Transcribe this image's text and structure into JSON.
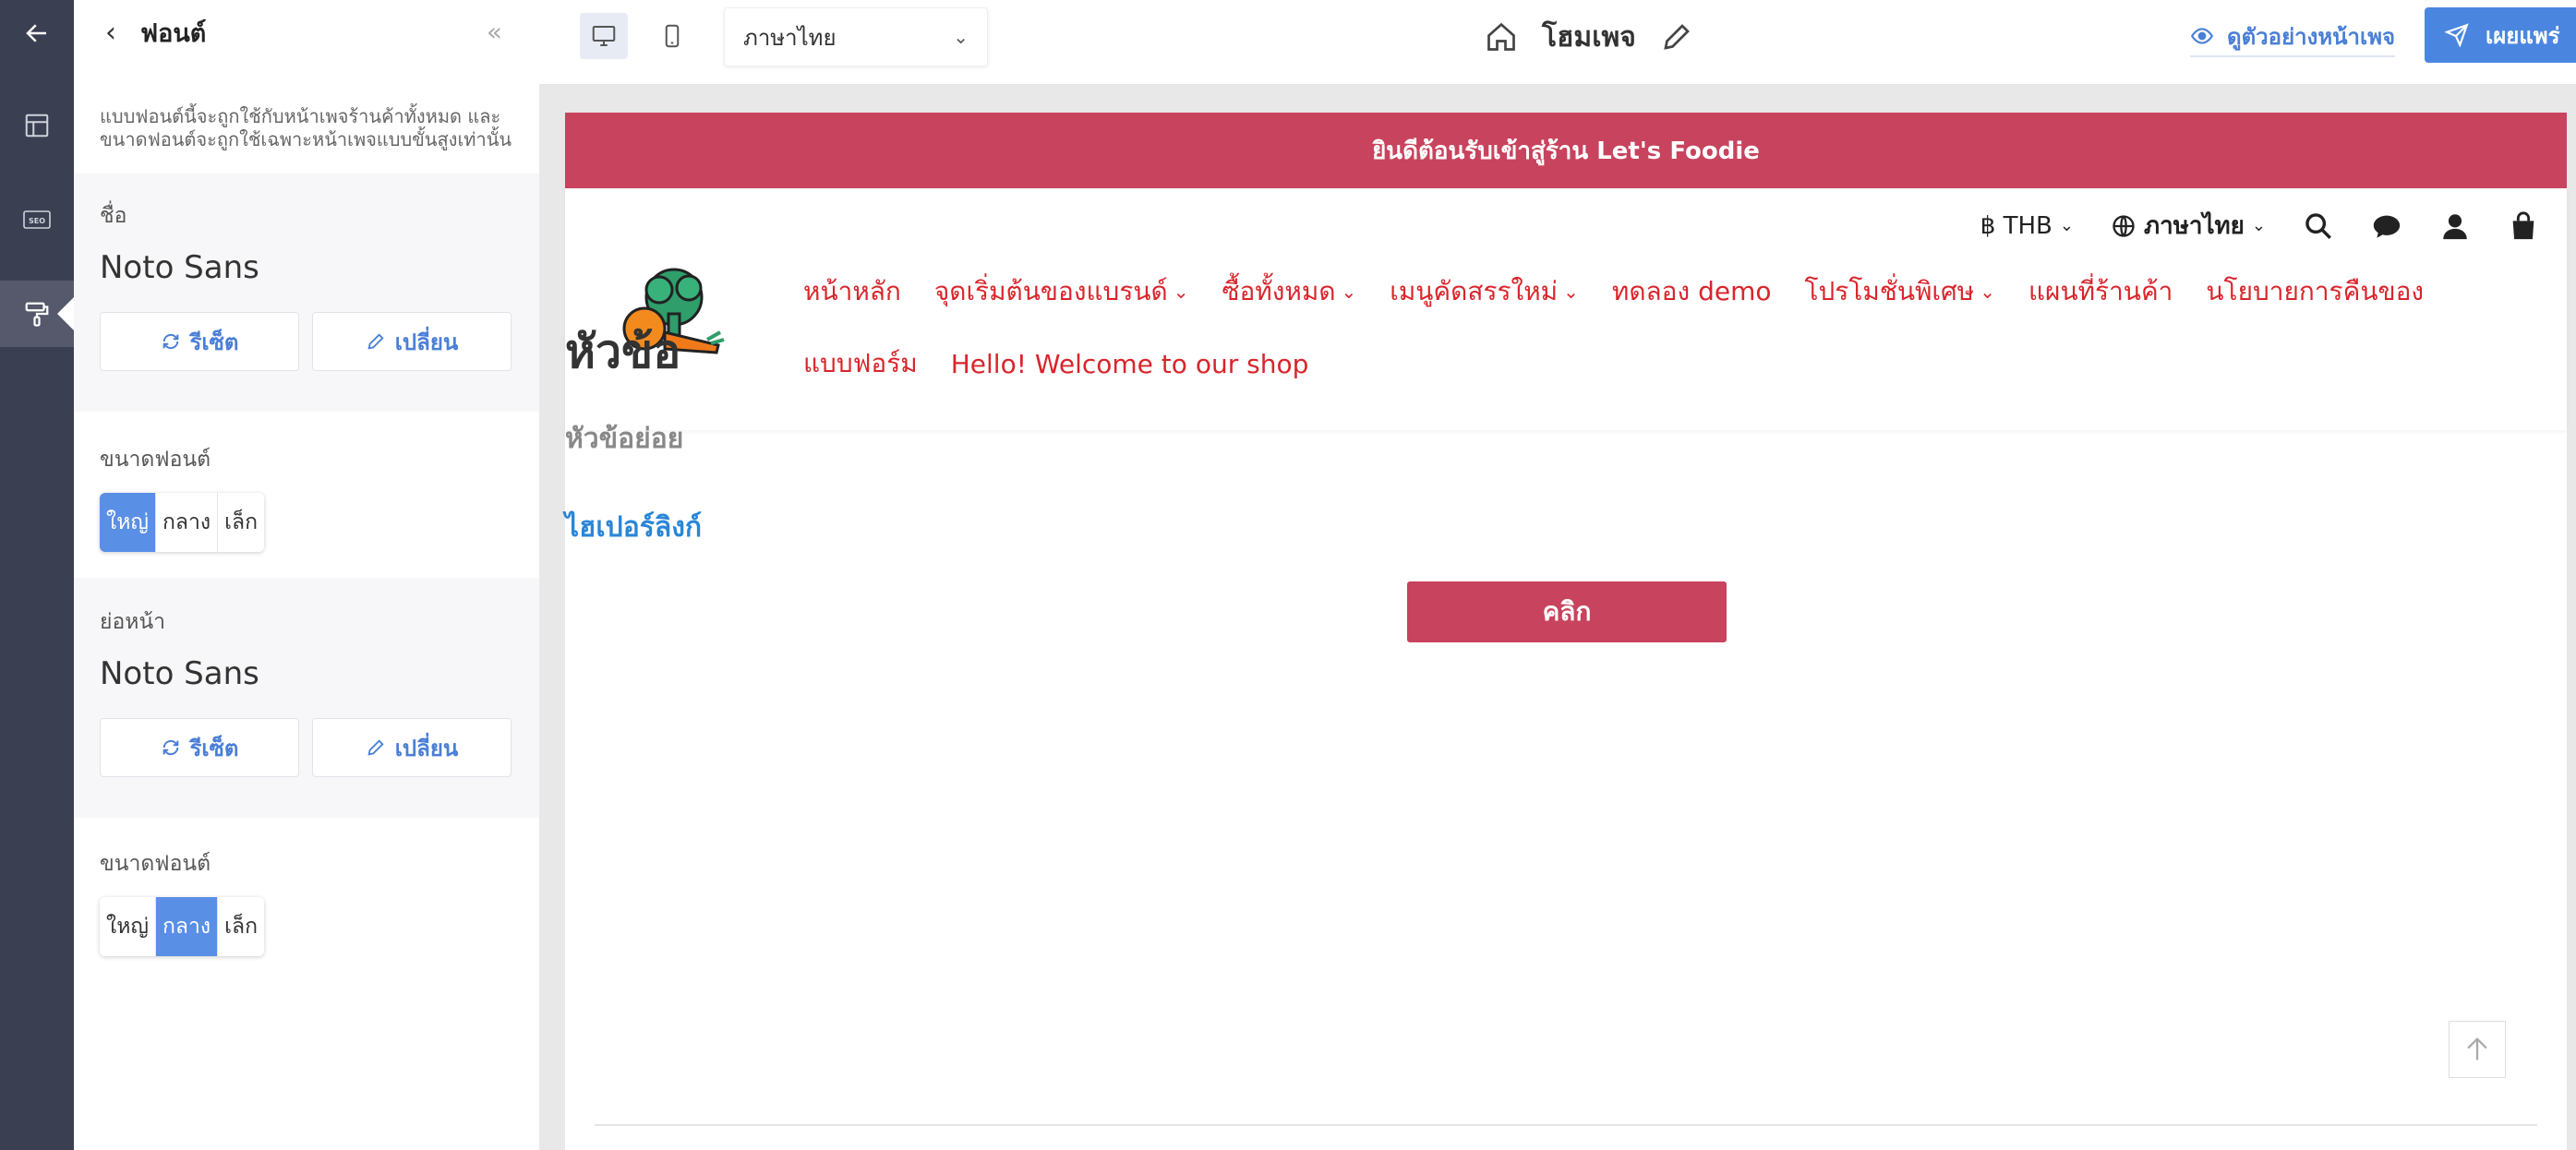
{
  "panel": {
    "title": "ฟอนต์",
    "description": "แบบฟอนต์นี้จะถูกใช้กับหน้าเพจร้านค้าทั้งหมด และขนาดฟอนต์จะถูกใช้เฉพาะหน้าเพจแบบขั้นสูงเท่านั้น",
    "heading_section": {
      "label": "ชื่อ",
      "font": "Noto Sans",
      "reset_label": "รีเซ็ต",
      "change_label": "เปลี่ยน",
      "size_label": "ขนาดฟอนต์",
      "sizes": [
        "ใหญ่",
        "กลาง",
        "เล็ก"
      ],
      "selected_size": "ใหญ่"
    },
    "body_section": {
      "label": "ย่อหน้า",
      "font": "Noto Sans",
      "reset_label": "รีเซ็ต",
      "change_label": "เปลี่ยน",
      "size_label": "ขนาดฟอนต์",
      "sizes": [
        "ใหญ่",
        "กลาง",
        "เล็ก"
      ],
      "selected_size": "กลาง"
    }
  },
  "topbar": {
    "language": "ภาษาไทย",
    "page_name": "โฮมเพจ",
    "preview_label": "ดูตัวอย่างหน้าเพจ",
    "publish_label": "เผยแพร่"
  },
  "store": {
    "announcement": "ยินดีต้อนรับเข้าสู่ร้าน Let's Foodie",
    "currency": "฿ THB",
    "language": "ภาษาไทย",
    "menu": [
      {
        "label": "หน้าหลัก",
        "has_dropdown": false
      },
      {
        "label": "จุดเริ่มต้นของแบรนด์",
        "has_dropdown": true
      },
      {
        "label": "ซื้อทั้งหมด",
        "has_dropdown": true
      },
      {
        "label": "เมนูคัดสรรใหม่",
        "has_dropdown": true
      },
      {
        "label": "ทดลอง demo",
        "has_dropdown": false
      },
      {
        "label": "โปรโมชั่นพิเศษ",
        "has_dropdown": true
      },
      {
        "label": "แผนที่ร้านค้า",
        "has_dropdown": false
      },
      {
        "label": "นโยบายการคืนของ",
        "has_dropdown": false
      },
      {
        "label": "แบบฟอร์ม",
        "has_dropdown": false
      },
      {
        "label": "Hello! Welcome to our shop",
        "has_dropdown": false
      }
    ],
    "heading": "หัวข้อ",
    "subheading": "หัวข้อย่อย",
    "hyperlink": "ไฮเปอร์ลิงก์",
    "button_label": "คลิก"
  },
  "icons": {
    "rail": [
      "back-arrow-icon",
      "layout-icon",
      "seo-icon",
      "paint-roller-icon"
    ],
    "header": [
      "search-icon",
      "chat-icon",
      "user-icon",
      "shopping-bag-icon"
    ]
  },
  "colors": {
    "brand": "#c8435d",
    "menu_link": "#d9252b",
    "accent_blue": "#4a86e0",
    "rail": "#3a3f51"
  }
}
